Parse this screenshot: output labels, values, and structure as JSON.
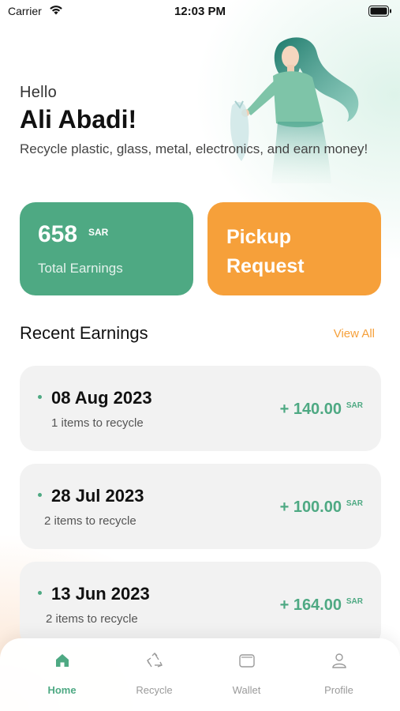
{
  "status_bar": {
    "carrier": "Carrier",
    "time": "12:03 PM",
    "icons": [
      "wifi-icon",
      "battery-icon"
    ]
  },
  "greeting": {
    "hello": "Hello",
    "name": "Ali Abadi!",
    "tagline": "Recycle plastic, glass, metal, electronics, and earn money!"
  },
  "cards": {
    "earnings": {
      "amount": "658",
      "currency": "SAR",
      "label": "Total Earnings",
      "color": "#4ea983"
    },
    "pickup": {
      "label": "Pickup Request",
      "color": "#f6a03a"
    }
  },
  "recent": {
    "title": "Recent Earnings",
    "view_all": "View All",
    "items": [
      {
        "date": "08 Aug 2023",
        "count": "1 items to recycle",
        "amount": "+ 140.00",
        "currency": "SAR"
      },
      {
        "date": "28 Jul 2023",
        "count": "2 items to recycle",
        "amount": "+ 100.00",
        "currency": "SAR"
      },
      {
        "date": "13 Jun 2023",
        "count": "2 items to recycle",
        "amount": "+ 164.00",
        "currency": "SAR"
      }
    ]
  },
  "tabs": [
    {
      "label": "Home",
      "icon": "home-icon",
      "active": true
    },
    {
      "label": "Recycle",
      "icon": "recycle-icon",
      "active": false
    },
    {
      "label": "Wallet",
      "icon": "wallet-icon",
      "active": false
    },
    {
      "label": "Profile",
      "icon": "profile-icon",
      "active": false
    }
  ],
  "colors": {
    "accent_green": "#4ea983",
    "accent_orange": "#f6a03a",
    "card_bg": "#f2f2f2",
    "inactive_tab": "#9a9a9a"
  }
}
